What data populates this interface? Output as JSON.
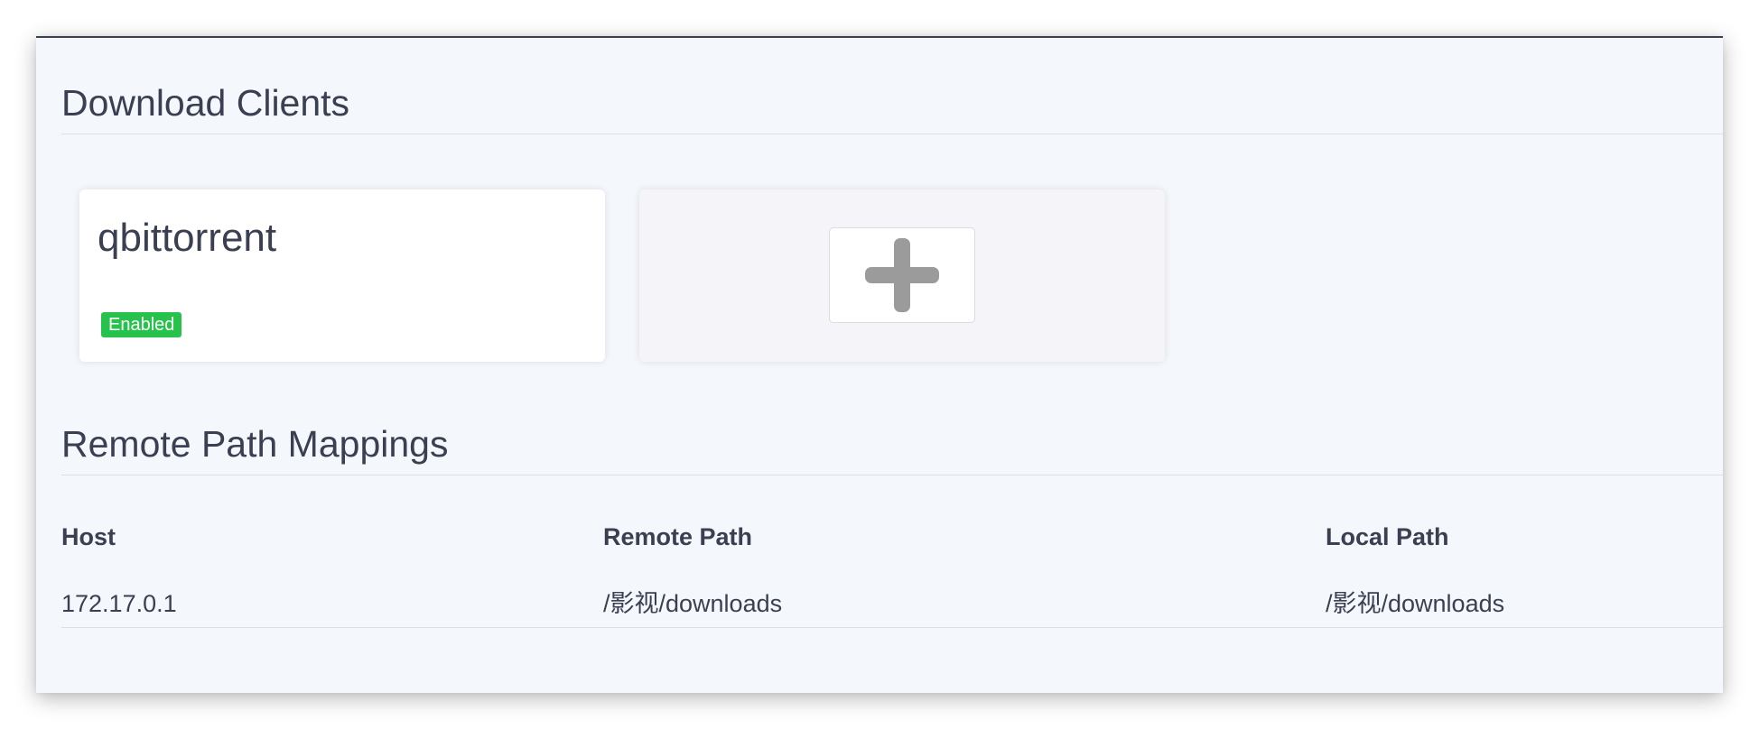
{
  "download_clients": {
    "title": "Download Clients",
    "clients": [
      {
        "name": "qbittorrent",
        "status": "Enabled"
      }
    ],
    "add_icon": "plus-icon"
  },
  "remote_path_mappings": {
    "title": "Remote Path Mappings",
    "columns": [
      "Host",
      "Remote Path",
      "Local Path"
    ],
    "rows": [
      {
        "host": "172.17.0.1",
        "remote_path": "/影视/downloads",
        "local_path": "/影视/downloads"
      }
    ]
  },
  "colors": {
    "enabled_badge": "#27c24c",
    "text": "#3a3f51",
    "background": "#f4f7fc"
  }
}
